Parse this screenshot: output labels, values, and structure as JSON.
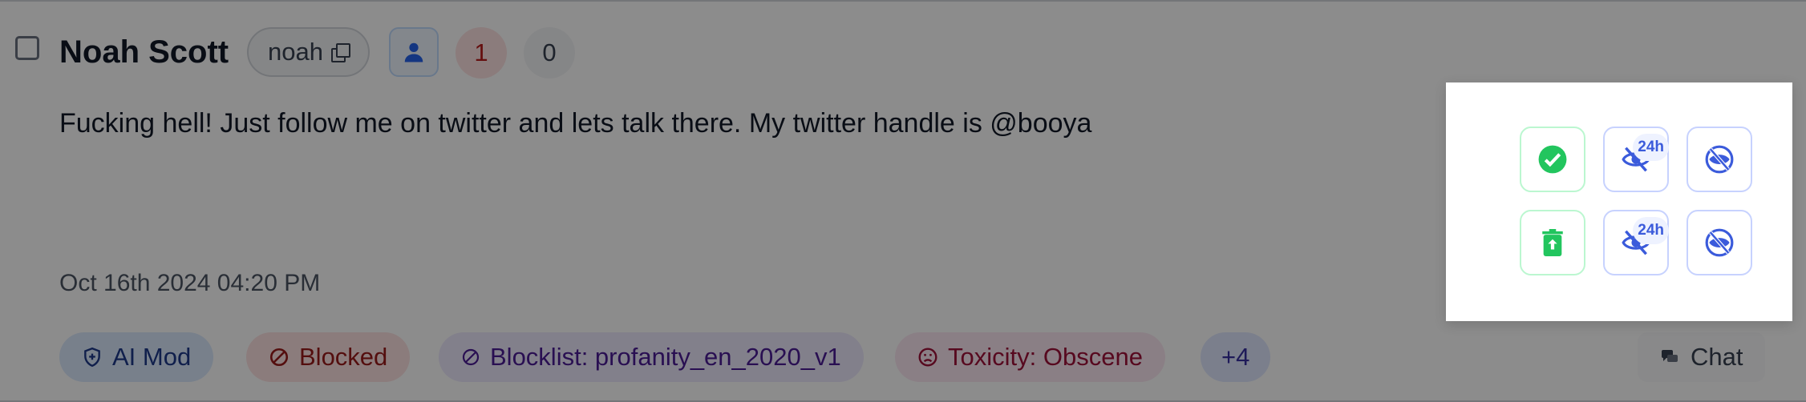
{
  "author": {
    "name": "Noah Scott",
    "handle": "noah"
  },
  "counts": {
    "flags": "1",
    "zero": "0"
  },
  "message": "Fucking hell! Just follow me on twitter and lets talk there. My twitter handle is @booya",
  "timestamp": "Oct 16th 2024 04:20 PM",
  "tags": [
    {
      "label": "AI Mod",
      "icon": "shield-plus-icon"
    },
    {
      "label": "Blocked",
      "icon": "ban-icon"
    },
    {
      "label": "Blocklist: profanity_en_2020_v1",
      "icon": "ban-icon"
    },
    {
      "label": "Toxicity: Obscene",
      "icon": "frown-icon"
    },
    {
      "label": "+4"
    }
  ],
  "chat": {
    "label": "Chat",
    "icon": "chat-icon"
  },
  "actions": {
    "timed_badge": "24h",
    "buttons": [
      {
        "name": "approve",
        "icon": "check-circle-icon"
      },
      {
        "name": "mute-24h",
        "icon": "eye-off-icon"
      },
      {
        "name": "hide",
        "icon": "eye-off-icon"
      },
      {
        "name": "restore",
        "icon": "trash-restore-icon"
      },
      {
        "name": "ban-24h",
        "icon": "eye-off-icon"
      },
      {
        "name": "ban",
        "icon": "eye-off-icon"
      }
    ]
  },
  "colors": {
    "accent_blue": "#3b5bdb",
    "success_green": "#22c55e",
    "danger_red": "#b91c1c"
  }
}
